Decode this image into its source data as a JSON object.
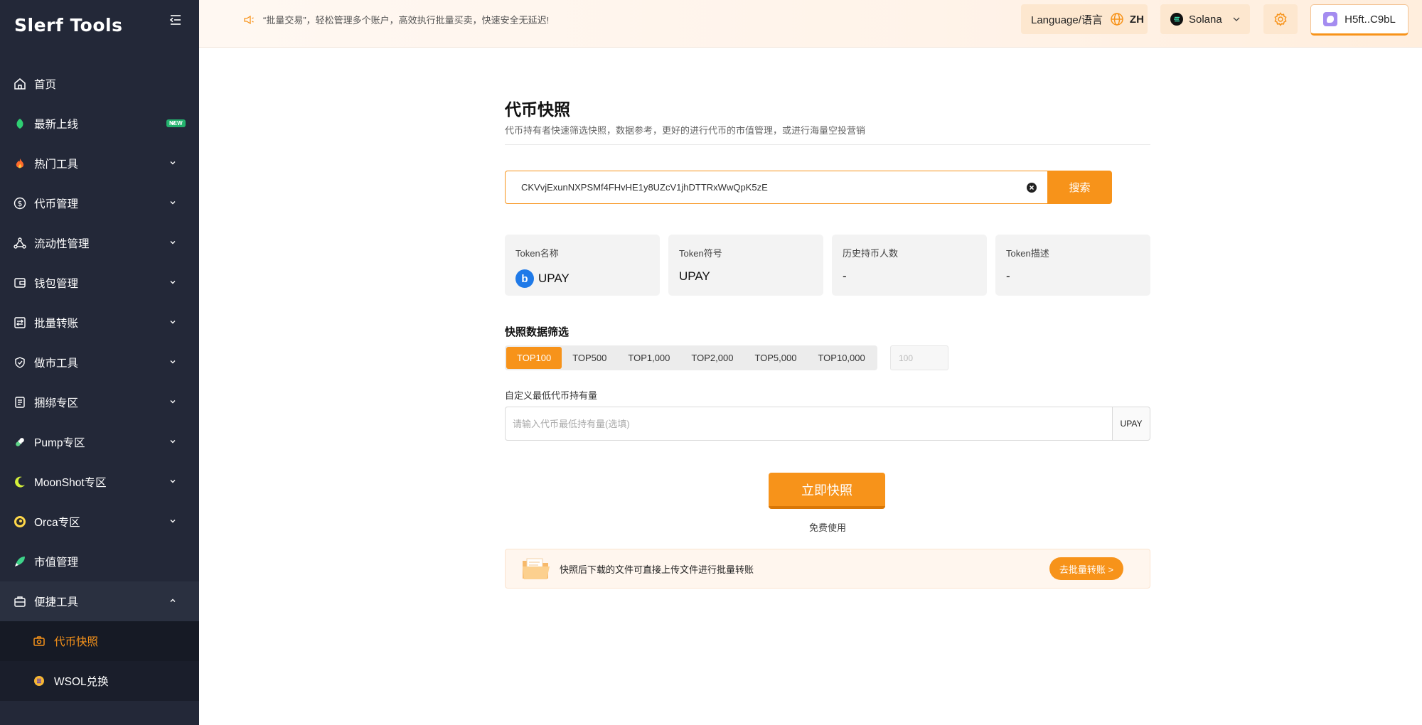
{
  "app": {
    "logo": "Slerf Tools",
    "accent_color": "#f7931a",
    "sidebar_bg": "#232838"
  },
  "header": {
    "notice": "“批量交易”，轻松管理多个账户，高效执行批量买卖，快速安全无延迟!",
    "language_label": "Language/语言",
    "language_code": "ZH",
    "chain": "Solana",
    "wallet": "H5ft..C9bL"
  },
  "sidebar": {
    "items": [
      {
        "label": "首页",
        "icon": "home-icon"
      },
      {
        "label": "最新上线",
        "icon": "leaf-icon",
        "badge": "NEW"
      },
      {
        "label": "热门工具",
        "icon": "fire-icon"
      },
      {
        "label": "代币管理",
        "icon": "dollar-icon"
      },
      {
        "label": "流动性管理",
        "icon": "network-icon"
      },
      {
        "label": "钱包管理",
        "icon": "wallet-icon"
      },
      {
        "label": "批量转账",
        "icon": "transfer-icon"
      },
      {
        "label": "做市工具",
        "icon": "shield-icon"
      },
      {
        "label": "捆绑专区",
        "icon": "bundle-icon"
      },
      {
        "label": "Pump专区",
        "icon": "pill-icon"
      },
      {
        "label": "MoonShot专区",
        "icon": "moon-icon"
      },
      {
        "label": "Orca专区",
        "icon": "orca-icon"
      },
      {
        "label": "市值管理",
        "icon": "rocket-icon"
      },
      {
        "label": "便捷工具",
        "icon": "toolbox-icon"
      }
    ],
    "sub_items": [
      {
        "label": "代币快照",
        "icon": "camera-icon",
        "active": true
      },
      {
        "label": "WSOL兑换",
        "icon": "coin-icon"
      }
    ]
  },
  "main": {
    "title": "代币快照",
    "subtitle": "代币持有者快速筛选快照，数据参考，更好的进行代币的市值管理，或进行海量空投营销",
    "search_value": "CKVvjExunNXPSMf4FHvHE1y8UZcV1jhDTTRxWwQpK5zE",
    "search_button": "搜索",
    "cards": [
      {
        "label": "Token名称",
        "value": "UPAY"
      },
      {
        "label": "Token符号",
        "value": "UPAY"
      },
      {
        "label": "历史持币人数",
        "value": "-"
      },
      {
        "label": "Token描述",
        "value": "-"
      }
    ],
    "filter_label": "快照数据筛选",
    "tabs": [
      "TOP100",
      "TOP500",
      "TOP1,000",
      "TOP2,000",
      "TOP5,000",
      "TOP10,000"
    ],
    "active_tab": "TOP100",
    "custom_count_placeholder": "100",
    "min_label": "自定义最低代币持有量",
    "min_placeholder": "请输入代币最低持有量(选填)",
    "min_unit": "UPAY",
    "snapshot_button": "立即快照",
    "free_text": "免费使用",
    "tip_text": "快照后下载的文件可直接上传文件进行批量转账",
    "tip_button": "去批量转账 >"
  }
}
